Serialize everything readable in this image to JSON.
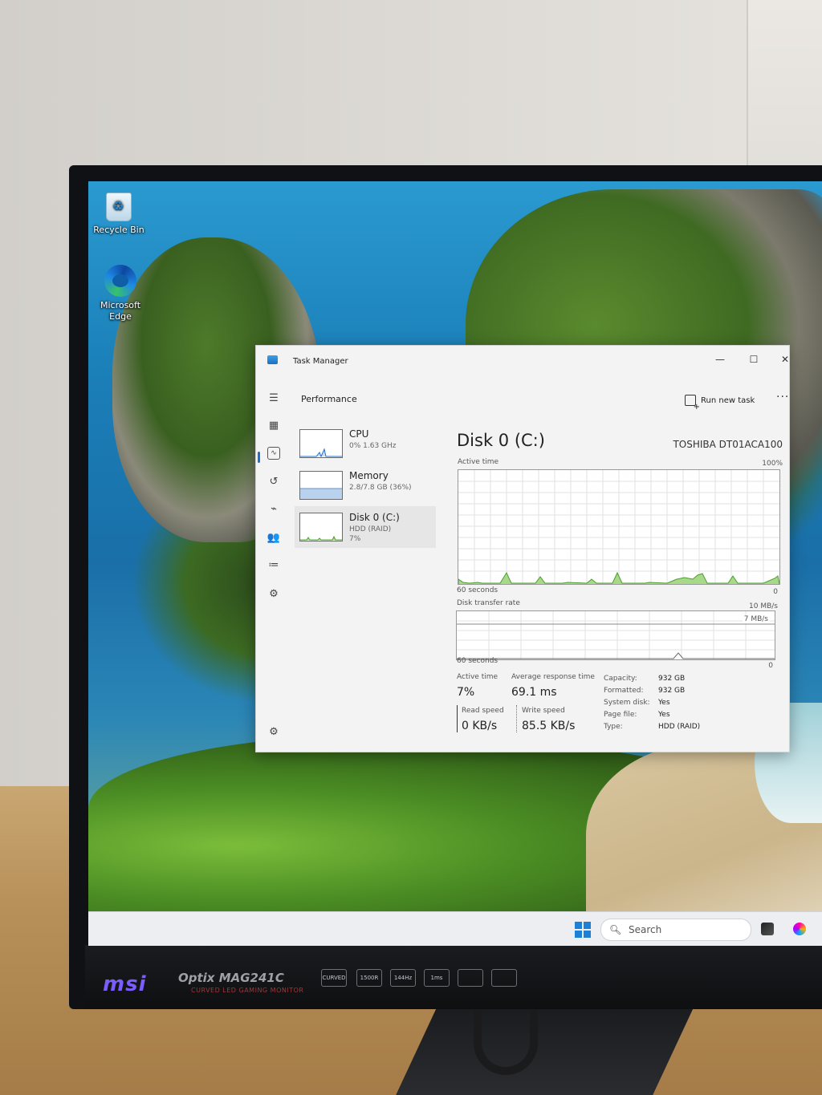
{
  "desktop": {
    "icons": [
      {
        "label": "Recycle Bin",
        "icon": "recycle-bin-icon"
      },
      {
        "label": "Microsoft Edge",
        "icon": "edge-icon"
      }
    ]
  },
  "window": {
    "title": "Task Manager",
    "controls": {
      "minimize": "—",
      "maximize": "☐",
      "close": "✕"
    }
  },
  "header": {
    "title": "Performance",
    "run_new_task": "Run new task",
    "more": "···"
  },
  "perf_list": [
    {
      "name": "CPU",
      "sub": "0% 1.63 GHz",
      "sub2": ""
    },
    {
      "name": "Memory",
      "sub": "2.8/7.8 GB (36%)",
      "sub2": ""
    },
    {
      "name": "Disk 0 (C:)",
      "sub": "HDD (RAID)",
      "sub2": "7%"
    }
  ],
  "detail": {
    "title": "Disk 0 (C:)",
    "model": "TOSHIBA DT01ACA100",
    "active_time_label": "Active time",
    "active_time_max": "100%",
    "graph1_seconds": "60 seconds",
    "graph1_min": "0",
    "transfer_label": "Disk transfer rate",
    "transfer_max": "10 MB/s",
    "transfer_line": "7 MB/s",
    "graph2_seconds": "60 seconds",
    "graph2_min": "0",
    "stats": {
      "active_time_label": "Active time",
      "active_time_value": "7%",
      "avg_response_label": "Average response time",
      "avg_response_value": "69.1 ms",
      "read_label": "Read speed",
      "read_value": "0 KB/s",
      "write_label": "Write speed",
      "write_value": "85.5 KB/s"
    },
    "properties": [
      {
        "key": "Capacity:",
        "value": "932 GB"
      },
      {
        "key": "Formatted:",
        "value": "932 GB"
      },
      {
        "key": "System disk:",
        "value": "Yes"
      },
      {
        "key": "Page file:",
        "value": "Yes"
      },
      {
        "key": "Type:",
        "value": "HDD (RAID)"
      }
    ]
  },
  "taskbar": {
    "search_placeholder": "Search"
  },
  "monitor": {
    "brand": "msi",
    "model": "Optix MAG241C",
    "subtitle": "CURVED LED GAMING MONITOR",
    "features": [
      "CURVED",
      "1500R",
      "144Hz",
      "1ms",
      "",
      ""
    ]
  },
  "colors": {
    "accent": "#1f6fd1",
    "graph_line": "#4aa02c",
    "graph_fill": "#a8d88a",
    "memory_fill": "#b9d3ee"
  }
}
